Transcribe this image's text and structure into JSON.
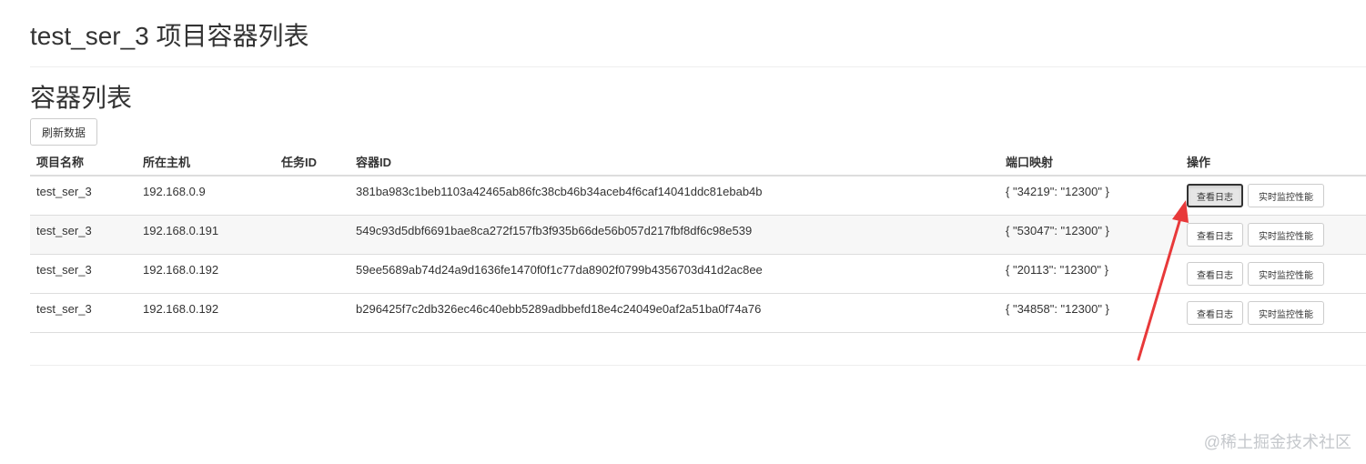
{
  "page": {
    "title": "test_ser_3 项目容器列表",
    "section_title": "容器列表",
    "refresh_label": "刷新数据"
  },
  "table": {
    "headers": {
      "project": "项目名称",
      "host": "所在主机",
      "task_id": "任务ID",
      "container_id": "容器ID",
      "port_mapping": "端口映射",
      "actions": "操作"
    },
    "rows": [
      {
        "project": "test_ser_3",
        "host": "192.168.0.9",
        "task_id": "",
        "container_id": "381ba983c1beb1103a42465ab86fc38cb46b34aceb4f6caf14041ddc81ebab4b",
        "port_mapping": "{ \"34219\": \"12300\" }",
        "log_label": "查看日志",
        "monitor_label": "实时监控性能"
      },
      {
        "project": "test_ser_3",
        "host": "192.168.0.191",
        "task_id": "",
        "container_id": "549c93d5dbf6691bae8ca272f157fb3f935b66de56b057d217fbf8df6c98e539",
        "port_mapping": "{ \"53047\": \"12300\" }",
        "log_label": "查看日志",
        "monitor_label": "实时监控性能"
      },
      {
        "project": "test_ser_3",
        "host": "192.168.0.192",
        "task_id": "",
        "container_id": "59ee5689ab74d24a9d1636fe1470f0f1c77da8902f0799b4356703d41d2ac8ee",
        "port_mapping": "{ \"20113\": \"12300\" }",
        "log_label": "查看日志",
        "monitor_label": "实时监控性能"
      },
      {
        "project": "test_ser_3",
        "host": "192.168.0.192",
        "task_id": "",
        "container_id": "b296425f7c2db326ec46c40ebb5289adbbefd18e4c24049e0af2a51ba0f74a76",
        "port_mapping": "{ \"34858\": \"12300\" }",
        "log_label": "查看日志",
        "monitor_label": "实时监控性能"
      }
    ]
  },
  "watermark": "@稀土掘金技术社区",
  "colors": {
    "arrow": "#e8393a",
    "stripe": "#f7f7f7",
    "border": "#dddddd"
  }
}
